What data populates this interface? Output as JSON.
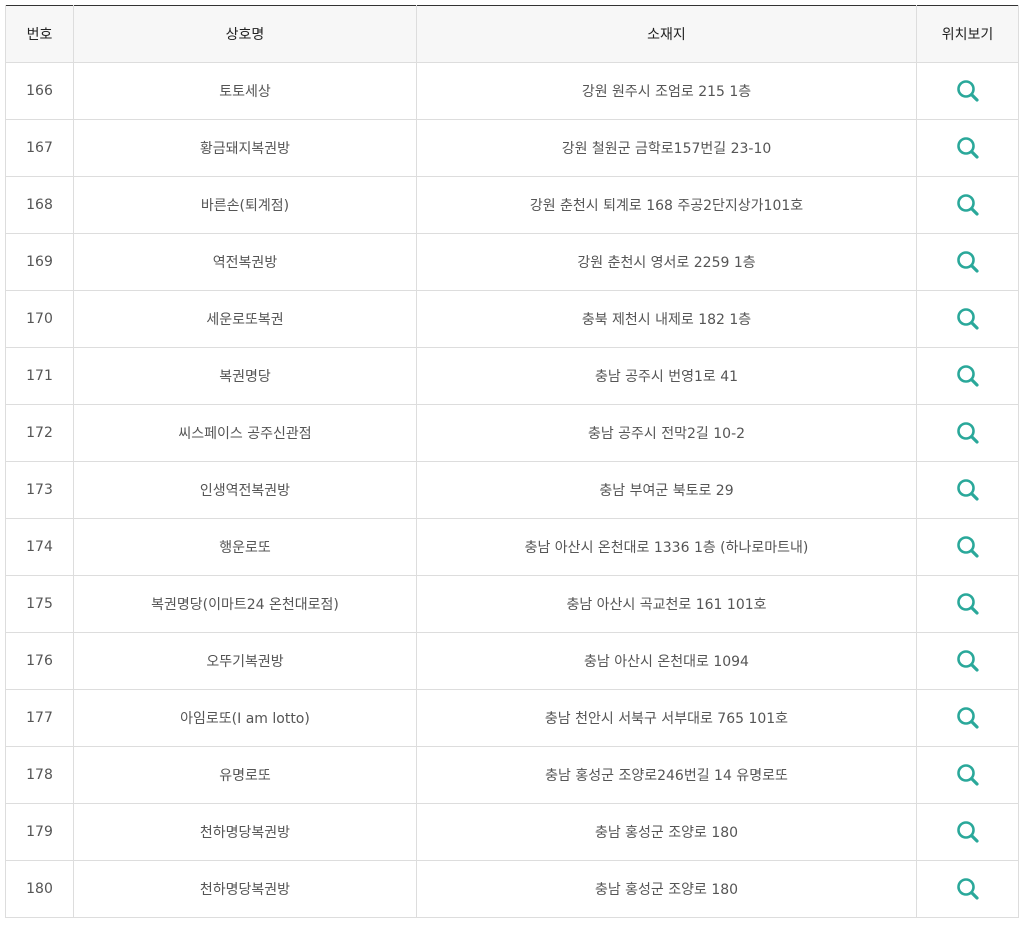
{
  "table": {
    "headers": {
      "number": "번호",
      "name": "상호명",
      "address": "소재지",
      "map": "위치보기"
    },
    "rows": [
      {
        "number": "166",
        "name": "토토세상",
        "address": "강원 원주시 조엄로 215 1층"
      },
      {
        "number": "167",
        "name": "황금돼지복권방",
        "address": "강원 철원군 금학로157번길 23-10"
      },
      {
        "number": "168",
        "name": "바른손(퇴계점)",
        "address": "강원 춘천시 퇴계로 168 주공2단지상가101호"
      },
      {
        "number": "169",
        "name": "역전복권방",
        "address": "강원 춘천시 영서로 2259 1층"
      },
      {
        "number": "170",
        "name": "세운로또복권",
        "address": "충북 제천시 내제로 182 1층"
      },
      {
        "number": "171",
        "name": "복권명당",
        "address": "충남 공주시 번영1로 41"
      },
      {
        "number": "172",
        "name": "씨스페이스 공주신관점",
        "address": "충남 공주시 전막2길 10-2"
      },
      {
        "number": "173",
        "name": "인생역전복권방",
        "address": "충남 부여군 북토로 29"
      },
      {
        "number": "174",
        "name": "행운로또",
        "address": "충남 아산시 온천대로 1336 1층 (하나로마트내)"
      },
      {
        "number": "175",
        "name": "복권명당(이마트24 온천대로점)",
        "address": "충남 아산시 곡교천로 161 101호"
      },
      {
        "number": "176",
        "name": "오뚜기복권방",
        "address": "충남 아산시 온천대로 1094"
      },
      {
        "number": "177",
        "name": "아임로또(I am lotto)",
        "address": "충남 천안시 서북구 서부대로 765 101호"
      },
      {
        "number": "178",
        "name": "유명로또",
        "address": "충남 홍성군 조양로246번길 14 유명로또"
      },
      {
        "number": "179",
        "name": "천하명당복권방",
        "address": "충남 홍성군 조양로 180"
      },
      {
        "number": "180",
        "name": "천하명당복권방",
        "address": "충남 홍성군 조양로 180"
      }
    ]
  },
  "icons": {
    "map": "search-icon"
  },
  "colors": {
    "accent": "#2aa89a",
    "header_bg": "#f7f7f7",
    "border": "#dddddd",
    "top_border": "#333333"
  }
}
